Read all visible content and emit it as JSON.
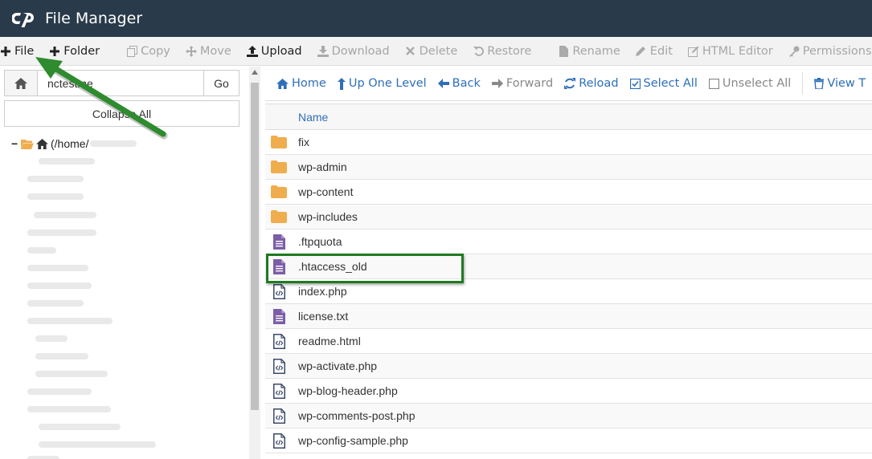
{
  "header": {
    "title": "File Manager",
    "logo_icon": "cpanel-logo-icon"
  },
  "toolbar": {
    "items": [
      {
        "label": "File",
        "icon": "plus-icon",
        "enabled": true
      },
      {
        "label": "Folder",
        "icon": "plus-icon",
        "enabled": true
      },
      {
        "label": "Copy",
        "icon": "copy-icon",
        "enabled": false
      },
      {
        "label": "Move",
        "icon": "move-icon",
        "enabled": false
      },
      {
        "label": "Upload",
        "icon": "upload-icon",
        "enabled": true
      },
      {
        "label": "Download",
        "icon": "download-icon",
        "enabled": false
      },
      {
        "label": "Delete",
        "icon": "close-icon",
        "enabled": false
      },
      {
        "label": "Restore",
        "icon": "undo-icon",
        "enabled": false
      },
      {
        "label": "Rename",
        "icon": "file-icon",
        "enabled": false
      },
      {
        "label": "Edit",
        "icon": "pencil-icon",
        "enabled": false
      },
      {
        "label": "HTML Editor",
        "icon": "edit-icon",
        "enabled": false
      },
      {
        "label": "Permissions",
        "icon": "key-icon",
        "enabled": false
      }
    ]
  },
  "left_panel": {
    "path_value": "nctestme",
    "go_label": "Go",
    "collapse_label": "Collapse All",
    "tree_root_label": "(/home/"
  },
  "nav": {
    "home": "Home",
    "up": "Up One Level",
    "back": "Back",
    "forward": "Forward",
    "reload": "Reload",
    "select_all": "Select All",
    "unselect_all": "Unselect All",
    "view_trash": "View T"
  },
  "files": {
    "column_name": "Name",
    "rows": [
      {
        "name": "fix",
        "type": "folder"
      },
      {
        "name": "wp-admin",
        "type": "folder"
      },
      {
        "name": "wp-content",
        "type": "folder"
      },
      {
        "name": "wp-includes",
        "type": "folder"
      },
      {
        "name": ".ftpquota",
        "type": "text"
      },
      {
        "name": ".htaccess_old",
        "type": "text"
      },
      {
        "name": "index.php",
        "type": "code"
      },
      {
        "name": "license.txt",
        "type": "text"
      },
      {
        "name": "readme.html",
        "type": "code"
      },
      {
        "name": "wp-activate.php",
        "type": "code"
      },
      {
        "name": "wp-blog-header.php",
        "type": "code"
      },
      {
        "name": "wp-comments-post.php",
        "type": "code"
      },
      {
        "name": "wp-config-sample.php",
        "type": "code"
      }
    ]
  },
  "colors": {
    "header_bg": "#293a4a",
    "link_blue": "#2e6fb8",
    "folder_orange": "#f0ad4e",
    "text_file_purple": "#7b5ea7",
    "annotation_green": "#1f7a1f"
  }
}
